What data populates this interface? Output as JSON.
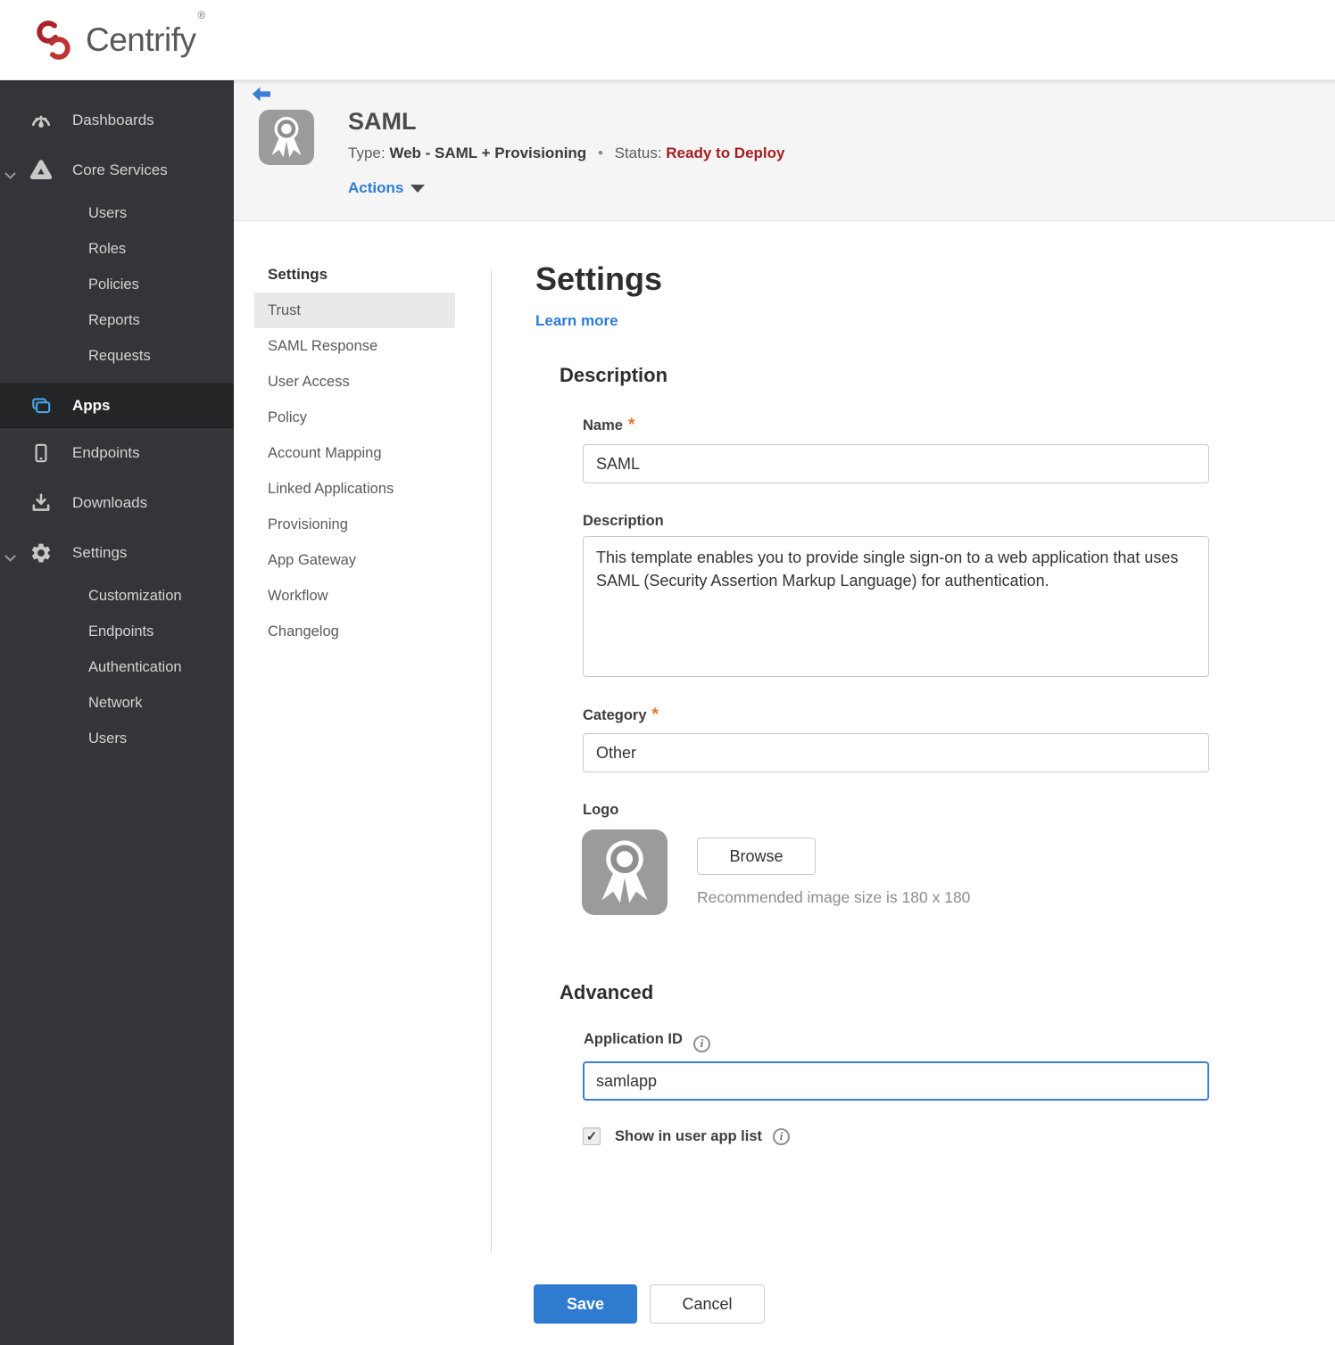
{
  "brand": {
    "name": "Centrify",
    "mark": "®"
  },
  "sidebar": {
    "items": [
      {
        "label": "Dashboards"
      },
      {
        "label": "Core Services",
        "expanded": true
      },
      {
        "label": "Users"
      },
      {
        "label": "Roles"
      },
      {
        "label": "Policies"
      },
      {
        "label": "Reports"
      },
      {
        "label": "Requests"
      },
      {
        "label": "Apps",
        "selected": true
      },
      {
        "label": "Endpoints"
      },
      {
        "label": "Downloads"
      },
      {
        "label": "Settings",
        "expanded": true
      },
      {
        "label": "Customization"
      },
      {
        "label": "Endpoints"
      },
      {
        "label": "Authentication"
      },
      {
        "label": "Network"
      },
      {
        "label": "Users"
      }
    ]
  },
  "app_header": {
    "title": "SAML",
    "type_label": "Type:",
    "type_value": "Web - SAML + Provisioning",
    "separator": "•",
    "status_label": "Status:",
    "status_value": "Ready to Deploy",
    "actions_label": "Actions"
  },
  "subnav": {
    "header": "Settings",
    "selected": "Trust",
    "items": [
      {
        "label": "Trust"
      },
      {
        "label": "SAML Response"
      },
      {
        "label": "User Access"
      },
      {
        "label": "Policy"
      },
      {
        "label": "Account Mapping"
      },
      {
        "label": "Linked Applications"
      },
      {
        "label": "Provisioning"
      },
      {
        "label": "App Gateway"
      },
      {
        "label": "Workflow"
      },
      {
        "label": "Changelog"
      }
    ]
  },
  "main": {
    "title": "Settings",
    "learn_more": "Learn more",
    "required_marker": "*",
    "description_section": {
      "heading": "Description",
      "name_label": "Name",
      "name_value": "SAML",
      "description_label": "Description",
      "description_value": "This template enables you to provide single sign-on to a web application that uses SAML (Security Assertion Markup Language) for authentication.",
      "category_label": "Category",
      "category_value": "Other",
      "logo_label": "Logo",
      "browse_button": "Browse",
      "logo_hint": "Recommended image size is 180 x 180"
    },
    "advanced_section": {
      "heading": "Advanced",
      "application_id_label": "Application ID",
      "application_id_value": "samlapp",
      "info_glyph": "i",
      "show_in_user_app_list_label": "Show in user app list",
      "checkbox_checked": true,
      "checkmark_glyph": "✓"
    },
    "buttons": {
      "save": "Save",
      "cancel": "Cancel"
    }
  },
  "colors": {
    "accent_blue": "#2e7bd0",
    "status_red": "#a51d20",
    "apps_icon_blue": "#47a3e2",
    "brand_red": "#b5282c",
    "sidebar_bg": "#333538",
    "header_band_bg": "#f5f5f6"
  }
}
